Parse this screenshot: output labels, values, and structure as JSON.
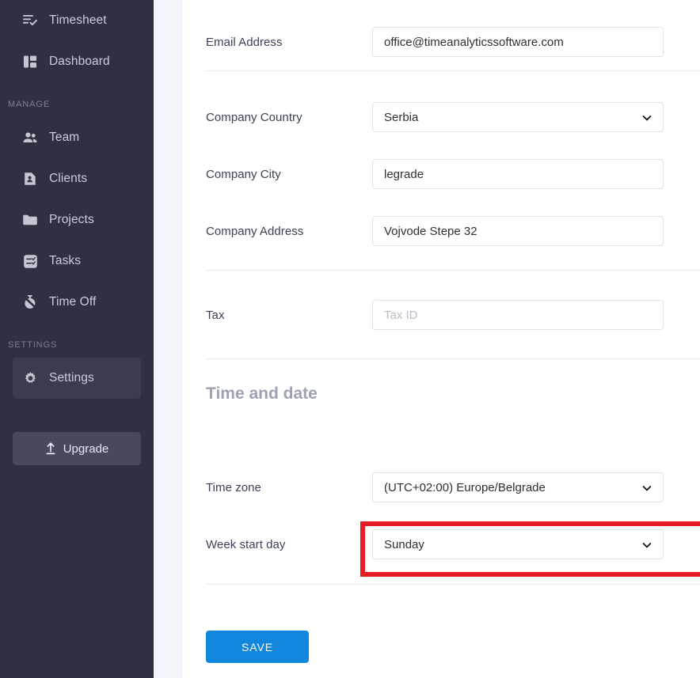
{
  "sidebar": {
    "items": [
      {
        "label": "Timesheet",
        "icon": "timesheet-check-icon",
        "active": false
      },
      {
        "label": "Dashboard",
        "icon": "dashboard-grid-icon",
        "active": false
      }
    ],
    "manage_section": {
      "title": "MANAGE",
      "items": [
        {
          "label": "Team",
          "icon": "people-icon",
          "active": false
        },
        {
          "label": "Clients",
          "icon": "contact-card-icon",
          "active": false
        },
        {
          "label": "Projects",
          "icon": "folder-icon",
          "active": false
        },
        {
          "label": "Tasks",
          "icon": "task-list-icon",
          "active": false
        },
        {
          "label": "Time Off",
          "icon": "stopwatch-off-icon",
          "active": false
        }
      ]
    },
    "settings_section": {
      "title": "SETTINGS",
      "items": [
        {
          "label": "Settings",
          "icon": "gear-icon",
          "active": true
        }
      ]
    },
    "upgrade": {
      "label": "Upgrade",
      "icon": "upload-arrow-icon"
    },
    "colors": {
      "background": "#2f3142",
      "active_item": "#3b3d4f",
      "text": "#c9cddb",
      "section_label": "#7b8094",
      "upgrade_bg": "#474a5d"
    }
  },
  "main": {
    "fields": {
      "email": {
        "label": "Email Address",
        "value": "office@timeanalyticssoftware.com",
        "placeholder": ""
      },
      "country": {
        "label": "Company Country",
        "value": "Serbia"
      },
      "city": {
        "label": "Company City",
        "value": "legrade",
        "placeholder": ""
      },
      "address": {
        "label": "Company Address",
        "value": "Vojvode Stepe 32",
        "placeholder": ""
      },
      "tax": {
        "label": "Tax",
        "value": "",
        "placeholder": "Tax ID"
      },
      "timezone": {
        "label": "Time zone",
        "value": "(UTC+02:00) Europe/Belgrade"
      },
      "week_start": {
        "label": "Week start day",
        "value": "Sunday"
      }
    },
    "section_heading": "Time and date",
    "save_label": "SAVE",
    "colors": {
      "save_button": "#1087dd",
      "highlight": "#e81c24",
      "heading": "#9ea3b3",
      "label": "#3c4257",
      "border": "#e0e2e6"
    }
  }
}
